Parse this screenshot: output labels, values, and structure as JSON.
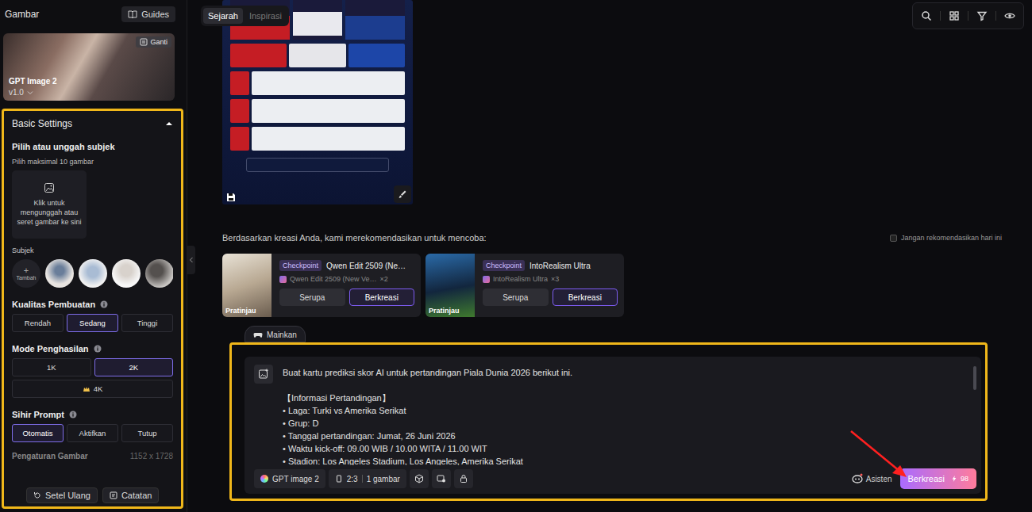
{
  "sidebar": {
    "title": "Gambar",
    "guides_button": "Guides",
    "model": {
      "name": "GPT Image 2",
      "version": "v1.0",
      "change_button": "Ganti"
    },
    "basic_settings": {
      "title": "Basic Settings",
      "expanded": true,
      "subject_upload": {
        "label": "Pilih atau unggah subjek",
        "hint": "Pilih maksimal 10 gambar",
        "dropzone": "Klik untuk mengunggah atau seret gambar ke sini"
      },
      "subjects": {
        "label": "Subjek",
        "add_icon": "+",
        "add_label": "Tambah",
        "items": [
          {
            "kind": "photo"
          },
          {
            "kind": "photo"
          },
          {
            "kind": "photo"
          },
          {
            "kind": "photo"
          }
        ]
      },
      "quality": {
        "label": "Kualitas Pembuatan",
        "options": [
          {
            "label": "Rendah",
            "selected": false
          },
          {
            "label": "Sedang",
            "selected": true
          },
          {
            "label": "Tinggi",
            "selected": false
          }
        ]
      },
      "mode": {
        "label": "Mode Penghasilan",
        "options": [
          {
            "label": "1K",
            "selected": false,
            "premium": false
          },
          {
            "label": "2K",
            "selected": true,
            "premium": false
          },
          {
            "label": "4K",
            "selected": false,
            "premium": true
          }
        ]
      },
      "prompt_magic": {
        "label": "Sihir Prompt",
        "options": [
          {
            "label": "Otomatis",
            "selected": true
          },
          {
            "label": "Aktifkan",
            "selected": false
          },
          {
            "label": "Tutup",
            "selected": false
          }
        ]
      },
      "image_settings": {
        "label": "Pengaturan Gambar",
        "value": "1152 x 1728"
      }
    },
    "footer_buttons": [
      "Setel Ulang",
      "Catatan"
    ]
  },
  "top_tabs": [
    {
      "label": "Sejarah",
      "selected": true
    },
    {
      "label": "Inspirasi",
      "selected": false
    }
  ],
  "recommendations": {
    "title": "Berdasarkan kreasi Anda, kami merekomendasikan untuk mencoba:",
    "dismiss": {
      "label": "Jangan rekomendasikan hari ini",
      "checked": false
    },
    "cards": [
      {
        "tag": "Checkpoint",
        "title": "Qwen Edit 2509 (Ne…",
        "subtitle": "Qwen Edit 2509 (New Ve…",
        "count": "×2",
        "preview_label": "Pratinjau",
        "buttons": [
          "Serupa",
          "Berkreasi"
        ]
      },
      {
        "tag": "Checkpoint",
        "title": "IntoRealism Ultra",
        "subtitle": "IntoRealism Ultra",
        "count": "×3",
        "preview_label": "Pratinjau",
        "buttons": [
          "Serupa",
          "Berkreasi"
        ]
      }
    ]
  },
  "play_chip": "Mainkan",
  "prompt": {
    "lines": [
      "Buat kartu prediksi skor AI untuk pertandingan Piala Dunia 2026 berikut ini.",
      "",
      "【Informasi Pertandingan】",
      "• Laga: Turki vs Amerika Serikat",
      "• Grup: D",
      "• Tanggal pertandingan: Jumat, 26 Juni 2026",
      "• Waktu kick-off: 09.00 WIB / 10.00 WITA / 11.00 WIT",
      "• Stadion: Los Angeles Stadium, Los Angeles, Amerika Serikat"
    ],
    "model": "GPT image 2",
    "ratio": "2:3",
    "quantity": "1 gambar",
    "assistant": "Asisten",
    "submit": {
      "label": "Berkreasi",
      "cost": "98"
    }
  }
}
